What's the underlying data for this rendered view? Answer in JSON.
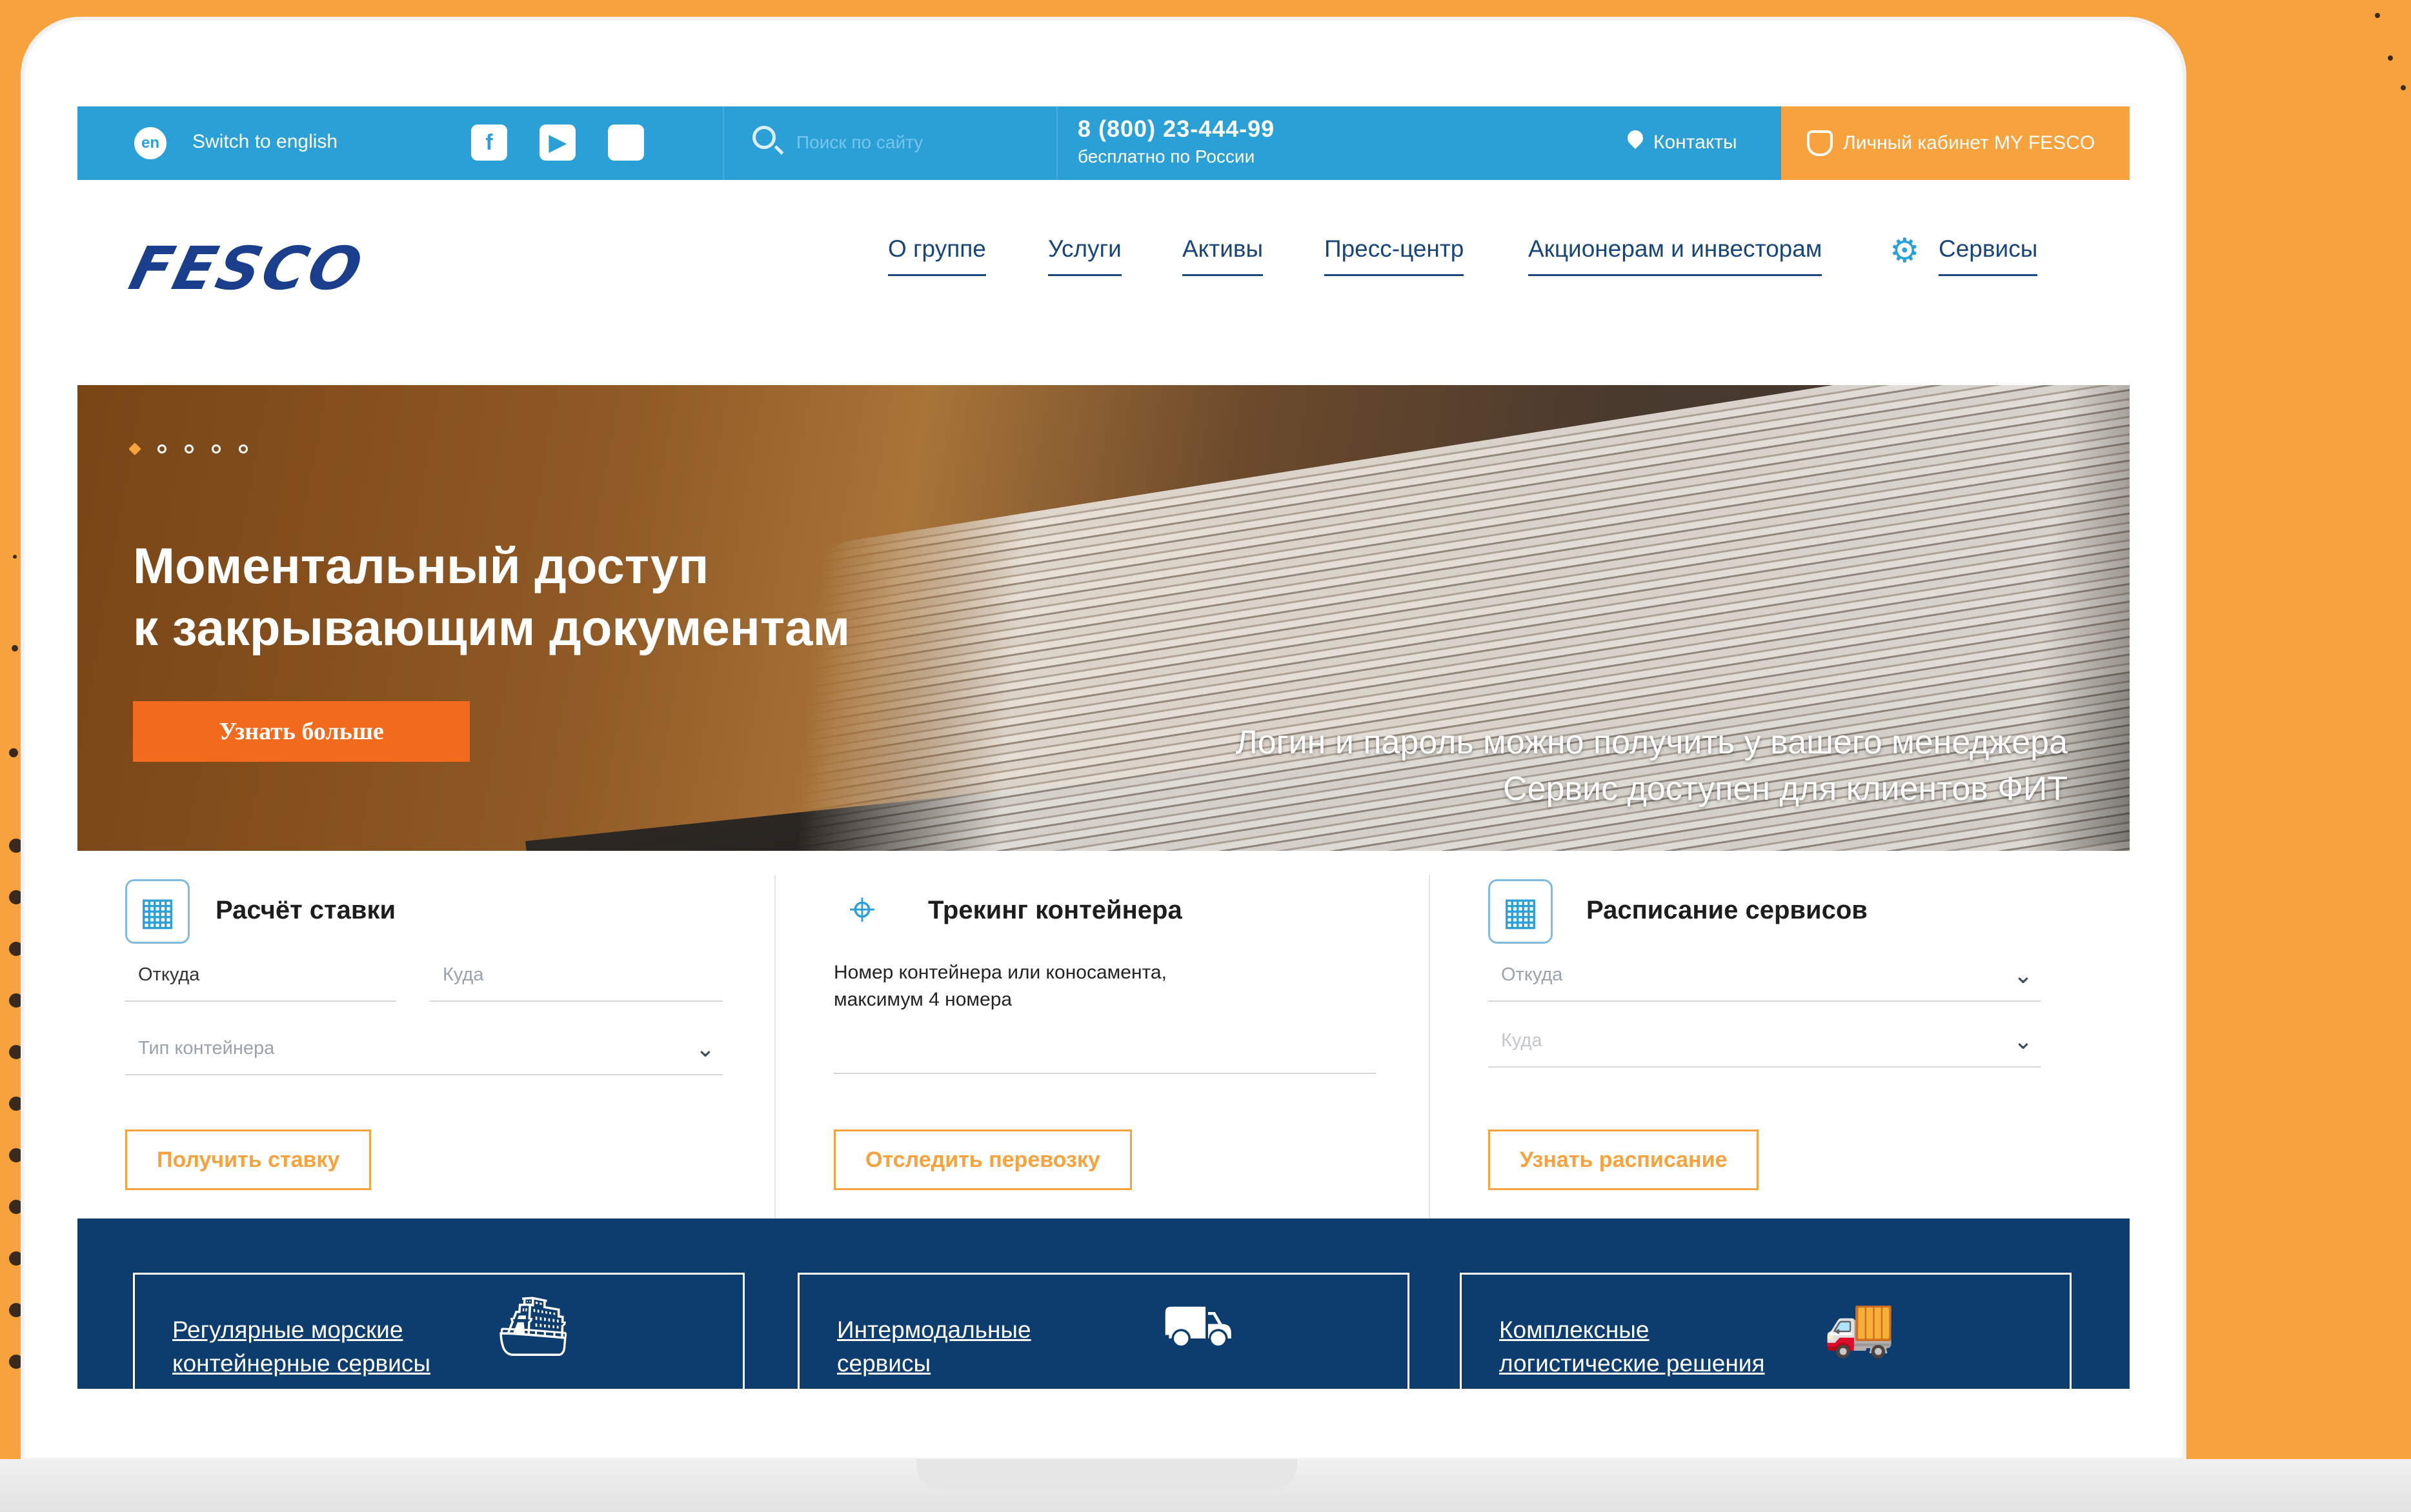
{
  "topbar": {
    "lang_badge": "en",
    "lang_switch": "Switch to english",
    "socials": [
      {
        "name": "facebook-icon",
        "glyph": "f"
      },
      {
        "name": "youtube-icon",
        "glyph": "▶"
      },
      {
        "name": "apple-icon",
        "glyph": ""
      }
    ],
    "search_placeholder": "Поиск по сайту",
    "phone": "8 (800) 23-444-99",
    "phone_note": "бесплатно по России",
    "contacts": "Контакты",
    "cabinet": "Личный кабинет MY FESCO"
  },
  "header": {
    "logo": "FESCO",
    "nav": [
      "О группе",
      "Услуги",
      "Активы",
      "Пресс-центр",
      "Акционерам и инвесторам",
      "Сервисы"
    ]
  },
  "hero": {
    "title": "Моментальный доступ\nк закрывающим документам",
    "button": "Узнать больше",
    "note": "Логин и пароль можно получить у вашего менеджера\nСервис доступен для клиентов ФИТ",
    "slides": 5,
    "active_slide": 1
  },
  "rate": {
    "title": "Расчёт ставки",
    "from": "Откуда",
    "to": "Куда",
    "container_type": "Тип контейнера",
    "button": "Получить ставку"
  },
  "tracking": {
    "title": "Трекинг контейнера",
    "hint": "Номер контейнера или коносамента,\nмаксимум 4 номера",
    "button": "Отследить перевозку"
  },
  "schedule": {
    "title": "Расписание сервисов",
    "from": "Откуда",
    "to": "Куда",
    "button": "Узнать расписание"
  },
  "services": [
    {
      "label": "Регулярные морские\nконтейнерные сервисы",
      "icon": "ship-icon"
    },
    {
      "label": "Интермодальные\nсервисы",
      "icon": "truck-crane-icon"
    },
    {
      "label": "Комплексные\nлогистические решения",
      "icon": "truck-icon"
    }
  ],
  "colors": {
    "topbar": "#2aa0d6",
    "accent": "#f7a23c",
    "cta": "#f26b1d",
    "navy": "#0d3d6e",
    "nav_text": "#18467a"
  }
}
